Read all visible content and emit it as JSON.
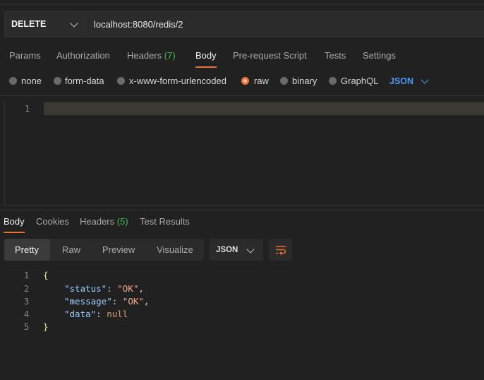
{
  "request": {
    "method": "DELETE",
    "url": "localhost:8080/redis/2"
  },
  "request_tabs": [
    {
      "label": "Params"
    },
    {
      "label": "Authorization"
    },
    {
      "label": "Headers",
      "count": "(7)"
    },
    {
      "label": "Body",
      "active": true
    },
    {
      "label": "Pre-request Script"
    },
    {
      "label": "Tests"
    },
    {
      "label": "Settings"
    }
  ],
  "body_types": [
    {
      "label": "none",
      "selected": false
    },
    {
      "label": "form-data",
      "selected": false
    },
    {
      "label": "x-www-form-urlencoded",
      "selected": false
    },
    {
      "label": "raw",
      "selected": true
    },
    {
      "label": "binary",
      "selected": false
    },
    {
      "label": "GraphQL",
      "selected": false
    }
  ],
  "raw_format": "JSON",
  "editor": {
    "line_numbers": [
      "1"
    ]
  },
  "response_tabs": [
    {
      "label": "Body",
      "active": true
    },
    {
      "label": "Cookies"
    },
    {
      "label": "Headers",
      "count": "(5)"
    },
    {
      "label": "Test Results"
    }
  ],
  "view_modes": [
    "Pretty",
    "Raw",
    "Preview",
    "Visualize"
  ],
  "active_view_mode": "Pretty",
  "response_format": "JSON",
  "response": {
    "line_numbers": [
      "1",
      "2",
      "3",
      "4",
      "5"
    ],
    "open_brace": "{",
    "close_brace": "}",
    "fields": [
      {
        "key": "\"status\"",
        "value": "\"OK\"",
        "sep": ","
      },
      {
        "key": "\"message\"",
        "value": "\"OK\"",
        "sep": ","
      },
      {
        "key": "\"data\"",
        "value": "null",
        "sep": ""
      }
    ]
  },
  "colors": {
    "accent": "#e8703a",
    "link": "#4e9bf2",
    "count": "#3fb950",
    "background": "#212121"
  },
  "icons": {
    "method_dropdown": "chevron-down-icon",
    "format_dropdown": "chevron-down-icon",
    "wrap": "wrap-lines-icon"
  }
}
